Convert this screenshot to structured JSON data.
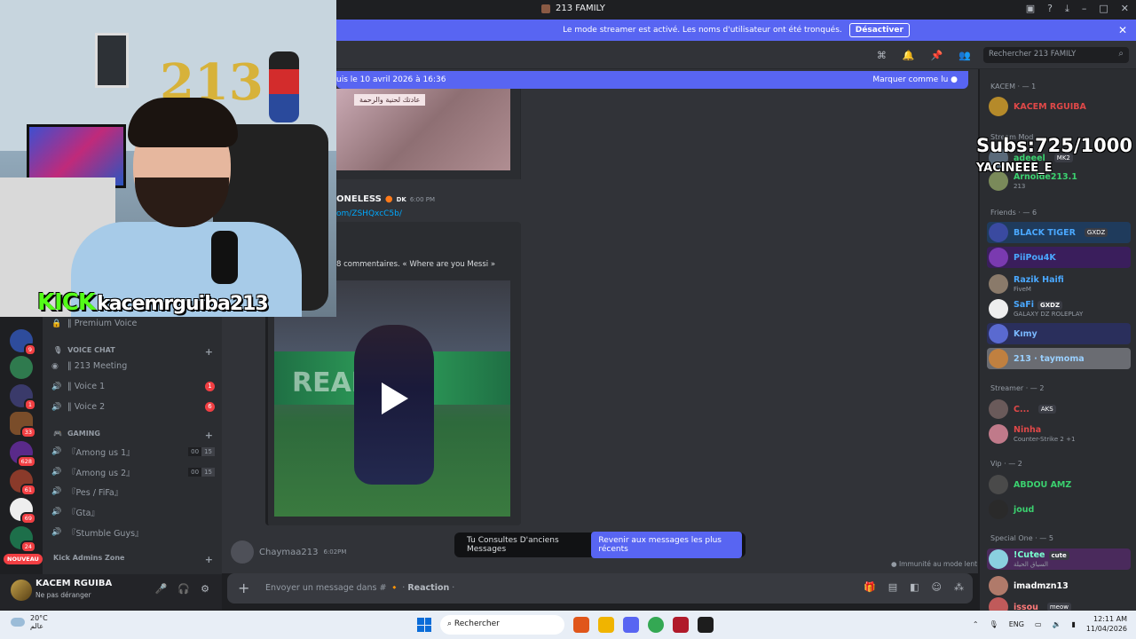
{
  "window": {
    "title": "213 FAMILY"
  },
  "streamer_bar": {
    "text": "Le mode streamer est activé. Les noms d'utilisateur ont été tronqués.",
    "button": "Désactiver"
  },
  "header": {
    "search_placeholder": "Rechercher 213 FAMILY"
  },
  "new_messages": {
    "text": "uis le 10 avril 2026 à 16:36",
    "mark_read": "Marquer comme lu"
  },
  "messages": [
    {
      "author": "ONELESS",
      "tag": "DK",
      "time": "6:00 PM",
      "link": "om/ZSHQxcC5b/",
      "embed_desc": "8 commentaires. « Where are you Messi » "
    },
    {
      "author": "Chaymaa213",
      "time": "6:02PM"
    }
  ],
  "blur_caption": "عادتك لحنية والرحمة",
  "old_messages_bar": {
    "text": "Tu Consultes D'anciens Messages",
    "button": "Revenir aux messages les plus récents"
  },
  "immunity": "Immunité au mode lent",
  "composer": {
    "placeholder": "Envoyer un message dans #",
    "reaction": "Reaction"
  },
  "servers": [
    {
      "badge": "9"
    },
    {
      "badge": ""
    },
    {
      "badge": "1"
    },
    {
      "badge": "33"
    },
    {
      "badge": "628"
    },
    {
      "badge": "61"
    },
    {
      "badge": "69"
    },
    {
      "badge": "24"
    }
  ],
  "nouveau": "NOUVEAU",
  "channels": {
    "premium": "‖ Premium Voice",
    "voice_cat": "VOICE CHAT",
    "meeting": "‖ 213 Meeting",
    "voice1": "‖ Voice 1",
    "voice1_badge": "1",
    "voice2": "‖ Voice 2",
    "voice2_badge": "6",
    "gaming_cat": "GAMING",
    "among1": "『Among us 1』",
    "among1_cnt": [
      "00",
      "15"
    ],
    "among2": "『Among us 2』",
    "among2_cnt": [
      "00",
      "15"
    ],
    "pes": "『Pes / FiFa』",
    "gta": "『Gta』",
    "stumble": "『Stumble Guys』",
    "kick_cat": "Kick Admins Zone"
  },
  "user": {
    "name": "KACEM RGUIBA",
    "status": "Ne pas déranger"
  },
  "members": {
    "kacem_group": "KACEM · — 1",
    "kacem": "KACEM RGUIBA",
    "mod_group": "Stream Mod",
    "adeeel": "adeeel",
    "adeeel_tag": "MK2",
    "arnolde": "Arnolde213.1",
    "arnolde_sub": "213",
    "friends_group": "Friends · — 6",
    "black_tiger": "BLACK TIGER",
    "black_tiger_tag": "GXDZ",
    "piipou": "PiiPou4K",
    "razik": "Razik Haifi",
    "razik_sub": "FiveM",
    "safi": "SaFi",
    "safi_tag": "GXDZ",
    "safi_sub": "GALAXY DZ ROLEPLAY",
    "kimy": "Kımy",
    "taymoma": "213 · taymoma",
    "streamer_group": "Streamer · — 2",
    "c": "C...",
    "c_tag": "AKS",
    "ninha": "Ninha",
    "ninha_sub": "Counter-Strike 2 +1",
    "vip_group": "Vip · — 2",
    "abdou": "ABDOU AMZ",
    "joud": "joud",
    "special_group": "Special One · — 5",
    "cutee": "!Cutee",
    "cutee_tag": "cute",
    "cutee_sub": "السياق الحيلة",
    "imad": "imadmzn13",
    "issou": "issou",
    "issou_tag": "meow"
  },
  "overlay": {
    "subs": "Subs:725/1000",
    "name": "YACINEEE_E"
  },
  "kick": {
    "brand": "KICK",
    "channel": "kacemrguiba213"
  },
  "taskbar": {
    "temp": "20°C",
    "weather_sub": "عالم",
    "search": "Rechercher",
    "lang": "ENG",
    "time": "12:11 AM",
    "date": "11/04/2026"
  }
}
